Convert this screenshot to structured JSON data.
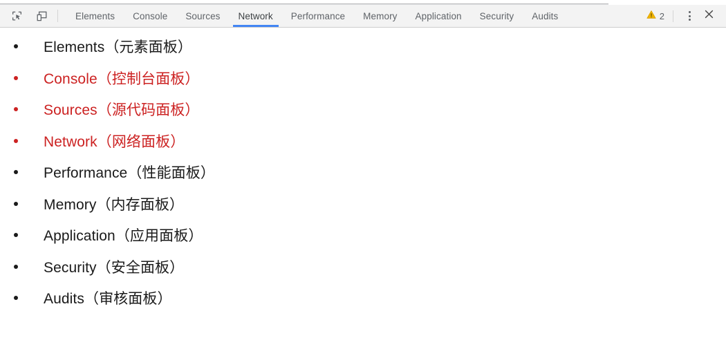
{
  "toolbar": {
    "tools": [
      {
        "name": "inspect-element-icon",
        "label": "Inspect element"
      },
      {
        "name": "device-toolbar-icon",
        "label": "Toggle device toolbar"
      }
    ],
    "tabs": [
      {
        "label": "Elements",
        "active": false
      },
      {
        "label": "Console",
        "active": false
      },
      {
        "label": "Sources",
        "active": false
      },
      {
        "label": "Network",
        "active": true
      },
      {
        "label": "Performance",
        "active": false
      },
      {
        "label": "Memory",
        "active": false
      },
      {
        "label": "Application",
        "active": false
      },
      {
        "label": "Security",
        "active": false
      },
      {
        "label": "Audits",
        "active": false
      }
    ],
    "warning": {
      "icon": "warning-triangle-icon",
      "count": "2"
    },
    "more_menu_icon": "more-vertical-icon",
    "close_icon": "close-icon",
    "active_tab_underline_color": "#4285f4",
    "inactive_tab_color": "#5f6368",
    "active_tab_color": "#3c4043"
  },
  "content": {
    "highlight_color": "#cc2222",
    "default_color": "#1a1a1a",
    "items": [
      {
        "text": "Elements（元素面板）",
        "highlighted": false
      },
      {
        "text": "Console（控制台面板）",
        "highlighted": true
      },
      {
        "text": "Sources（源代码面板）",
        "highlighted": true
      },
      {
        "text": "Network（网络面板）",
        "highlighted": true
      },
      {
        "text": "Performance（性能面板）",
        "highlighted": false
      },
      {
        "text": "Memory（内存面板）",
        "highlighted": false
      },
      {
        "text": "Application（应用面板）",
        "highlighted": false
      },
      {
        "text": "Security（安全面板）",
        "highlighted": false
      },
      {
        "text": "Audits（审核面板）",
        "highlighted": false
      }
    ]
  }
}
